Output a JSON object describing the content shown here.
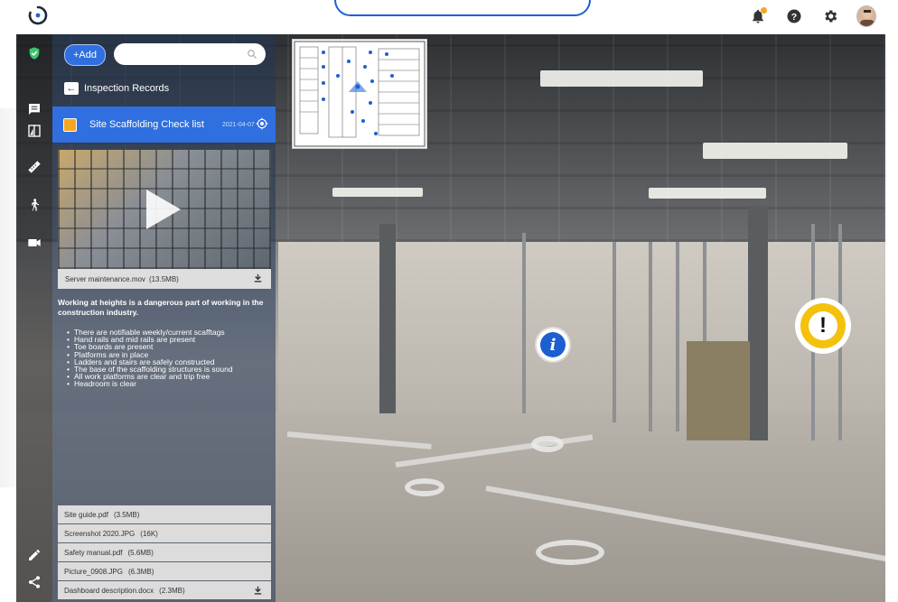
{
  "topbar": {
    "icons": [
      "notification-bell-icon",
      "help-icon",
      "settings-gear-icon",
      "user-avatar"
    ]
  },
  "toolbar": {
    "icons": [
      "shield-check-icon",
      "comment-icon",
      "compare-split-icon",
      "measure-ruler-icon",
      "walk-icon",
      "video-camera-icon",
      "edit-pencil-icon",
      "share-icon"
    ]
  },
  "panel": {
    "add_label": "+Add",
    "search_placeholder": "",
    "back_label": "Inspection Records",
    "record": {
      "title": "Site Scaffolding Check list",
      "date": "2021-04-07"
    },
    "video": {
      "filename": "Server maintenance.mov",
      "size": "(13.5MB)"
    },
    "description": {
      "heading": "Working at heights is a dangerous part of working in the construction industry.",
      "items": [
        "There are notifiable weekly/current scafftags",
        "Hand rails and mid rails are present",
        "Toe boards are present",
        "Platforms are in place",
        "Ladders and stairs are safely constructed",
        "The base of the scaffolding structures is sound",
        "All work platforms are clear and trip free",
        "Headroom is clear"
      ]
    },
    "files": [
      {
        "name": "Site guide.pdf",
        "size": "(3.5MB)"
      },
      {
        "name": "Screenshot 2020.JPG",
        "size": "(16K)"
      },
      {
        "name": "Safety manual.pdf",
        "size": "(5.6MB)"
      },
      {
        "name": "Picture_0908.JPG",
        "size": "(6.3MB)"
      },
      {
        "name": "Dashboard description.docx",
        "size": "(2.3MB)"
      }
    ]
  },
  "hotspots": {
    "info_glyph": "i",
    "warning_glyph": "!"
  },
  "colors": {
    "accent": "#2f6fe0",
    "warning": "#f4c20d",
    "notification": "#f5a623"
  }
}
